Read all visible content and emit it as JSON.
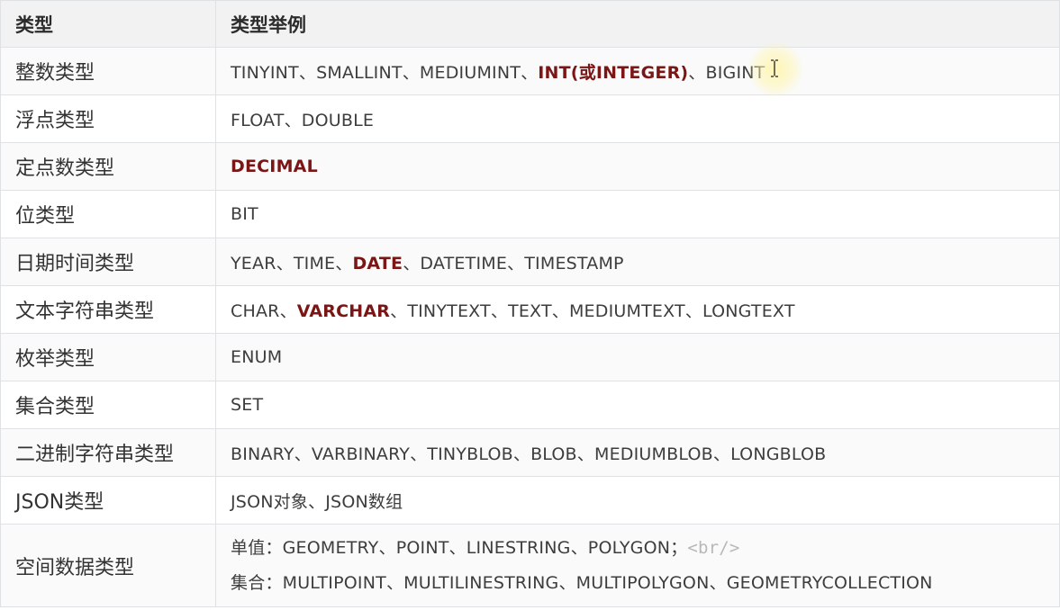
{
  "table": {
    "headers": [
      "类型",
      "类型举例"
    ],
    "rows": [
      {
        "category": "整数类型",
        "examples": [
          {
            "text": "TINYINT"
          },
          {
            "text": "、"
          },
          {
            "text": "SMALLINT"
          },
          {
            "text": "、"
          },
          {
            "text": "MEDIUMINT"
          },
          {
            "text": "、"
          },
          {
            "text": "INT(或INTEGER)",
            "highlight": true
          },
          {
            "text": "、"
          },
          {
            "text": "BIGINT"
          }
        ]
      },
      {
        "category": "浮点类型",
        "examples": [
          {
            "text": "FLOAT"
          },
          {
            "text": "、"
          },
          {
            "text": "DOUBLE"
          }
        ]
      },
      {
        "category": "定点数类型",
        "examples": [
          {
            "text": "DECIMAL",
            "highlight": true
          }
        ]
      },
      {
        "category": "位类型",
        "examples": [
          {
            "text": "BIT"
          }
        ]
      },
      {
        "category": "日期时间类型",
        "examples": [
          {
            "text": "YEAR"
          },
          {
            "text": "、"
          },
          {
            "text": "TIME"
          },
          {
            "text": "、"
          },
          {
            "text": "DATE",
            "highlight": true
          },
          {
            "text": "、"
          },
          {
            "text": "DATETIME"
          },
          {
            "text": "、"
          },
          {
            "text": "TIMESTAMP"
          }
        ]
      },
      {
        "category": "文本字符串类型",
        "examples": [
          {
            "text": "CHAR"
          },
          {
            "text": "、"
          },
          {
            "text": "VARCHAR",
            "highlight": true
          },
          {
            "text": "、"
          },
          {
            "text": "TINYTEXT"
          },
          {
            "text": "、"
          },
          {
            "text": "TEXT"
          },
          {
            "text": "、"
          },
          {
            "text": "MEDIUMTEXT"
          },
          {
            "text": "、"
          },
          {
            "text": "LONGTEXT"
          }
        ]
      },
      {
        "category": "枚举类型",
        "examples": [
          {
            "text": "ENUM"
          }
        ]
      },
      {
        "category": "集合类型",
        "examples": [
          {
            "text": "SET"
          }
        ]
      },
      {
        "category": "二进制字符串类型",
        "examples": [
          {
            "text": "BINARY"
          },
          {
            "text": "、"
          },
          {
            "text": "VARBINARY"
          },
          {
            "text": "、"
          },
          {
            "text": "TINYBLOB"
          },
          {
            "text": "、"
          },
          {
            "text": "BLOB"
          },
          {
            "text": "、"
          },
          {
            "text": "MEDIUMBLOB"
          },
          {
            "text": "、"
          },
          {
            "text": "LONGBLOB"
          }
        ]
      },
      {
        "category": "JSON类型",
        "examples": [
          {
            "text": "JSON对象"
          },
          {
            "text": "、"
          },
          {
            "text": "JSON数组"
          }
        ]
      },
      {
        "category": "空间数据类型",
        "lines": [
          [
            {
              "text": "单值："
            },
            {
              "text": "GEOMETRY"
            },
            {
              "text": "、"
            },
            {
              "text": "POINT"
            },
            {
              "text": "、"
            },
            {
              "text": "LINESTRING"
            },
            {
              "text": "、"
            },
            {
              "text": "POLYGON"
            },
            {
              "text": "；"
            },
            {
              "text": "<br/>",
              "tag": true
            }
          ],
          [
            {
              "text": "集合："
            },
            {
              "text": "MULTIPOINT"
            },
            {
              "text": "、"
            },
            {
              "text": "MULTILINESTRING"
            },
            {
              "text": "、"
            },
            {
              "text": "MULTIPOLYGON"
            },
            {
              "text": "、"
            },
            {
              "text": "GEOMETRYCOLLECTION"
            }
          ]
        ]
      }
    ]
  },
  "colors": {
    "highlight": "#7b1616",
    "header_bg": "#f2f2f2",
    "border": "#dfe2e5",
    "tag": "#b8b8b8"
  },
  "icons": {
    "cursor": "text-cursor-icon"
  }
}
